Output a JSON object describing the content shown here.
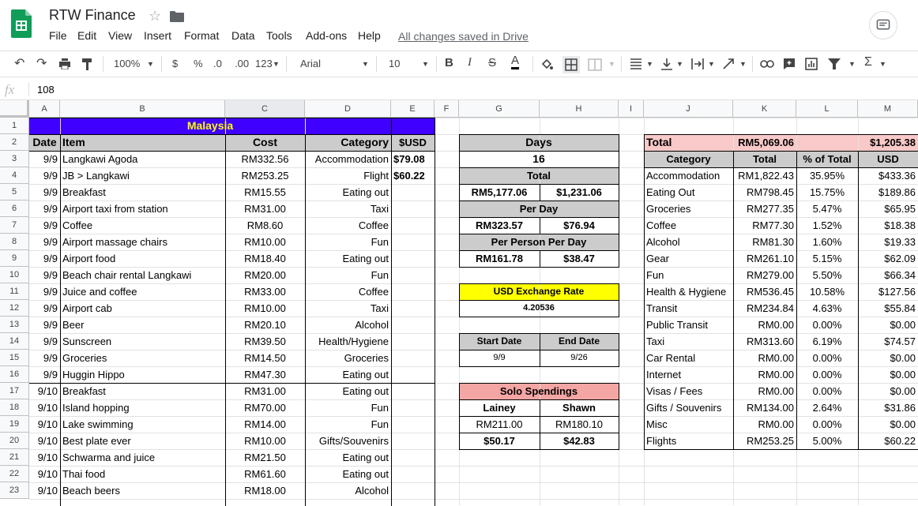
{
  "doc": {
    "title": "RTW Finance",
    "saved_status": "All changes saved in Drive",
    "menu": [
      "File",
      "Edit",
      "View",
      "Insert",
      "Format",
      "Data",
      "Tools",
      "Add-ons",
      "Help"
    ]
  },
  "toolbar": {
    "zoom": "100%",
    "currency": "$",
    "percent": "%",
    "dec_less": ".0",
    "dec_more": ".00",
    "format_more": "123",
    "font": "Arial",
    "font_size": "10"
  },
  "formula_bar": {
    "fx": "fx",
    "value": "108"
  },
  "columns": [
    "A",
    "B",
    "C",
    "D",
    "E",
    "F",
    "G",
    "H",
    "I",
    "J",
    "K",
    "L",
    "M"
  ],
  "rows": [
    "1",
    "2",
    "3",
    "4",
    "5",
    "6",
    "7",
    "8",
    "9",
    "10",
    "11",
    "12",
    "13",
    "14",
    "15",
    "16",
    "17",
    "18",
    "19",
    "20",
    "21",
    "22",
    "23"
  ],
  "left_table": {
    "banner": "Malaysia",
    "headers": {
      "date": "Date",
      "item": "Item",
      "cost": "Cost",
      "category": "Category",
      "usd": "$USD"
    },
    "rows": [
      {
        "date": "9/9",
        "item": "Langkawi Agoda",
        "cost": "RM332.56",
        "category": "Accommodation",
        "usd": "$79.08"
      },
      {
        "date": "9/9",
        "item": "JB > Langkawi",
        "cost": "RM253.25",
        "category": "Flight",
        "usd": "$60.22"
      },
      {
        "date": "9/9",
        "item": "Breakfast",
        "cost": "RM15.55",
        "category": "Eating out",
        "usd": ""
      },
      {
        "date": "9/9",
        "item": "Airport taxi from station",
        "cost": "RM31.00",
        "category": "Taxi",
        "usd": ""
      },
      {
        "date": "9/9",
        "item": "Coffee",
        "cost": "RM8.60",
        "category": "Coffee",
        "usd": ""
      },
      {
        "date": "9/9",
        "item": "Airport massage chairs",
        "cost": "RM10.00",
        "category": "Fun",
        "usd": ""
      },
      {
        "date": "9/9",
        "item": "Airport food",
        "cost": "RM18.40",
        "category": "Eating out",
        "usd": ""
      },
      {
        "date": "9/9",
        "item": "Beach chair rental Langkawi",
        "cost": "RM20.00",
        "category": "Fun",
        "usd": ""
      },
      {
        "date": "9/9",
        "item": "Juice and coffee",
        "cost": "RM33.00",
        "category": "Coffee",
        "usd": ""
      },
      {
        "date": "9/9",
        "item": "Airport cab",
        "cost": "RM10.00",
        "category": "Taxi",
        "usd": ""
      },
      {
        "date": "9/9",
        "item": "Beer",
        "cost": "RM20.10",
        "category": "Alcohol",
        "usd": ""
      },
      {
        "date": "9/9",
        "item": "Sunscreen",
        "cost": "RM39.50",
        "category": "Health/Hygiene",
        "usd": ""
      },
      {
        "date": "9/9",
        "item": "Groceries",
        "cost": "RM14.50",
        "category": "Groceries",
        "usd": ""
      },
      {
        "date": "9/9",
        "item": "Huggin Hippo",
        "cost": "RM47.30",
        "category": "Eating out",
        "usd": ""
      },
      {
        "date": "9/10",
        "item": "Breakfast",
        "cost": "RM31.00",
        "category": "Eating out",
        "usd": ""
      },
      {
        "date": "9/10",
        "item": "Island hopping",
        "cost": "RM70.00",
        "category": "Fun",
        "usd": ""
      },
      {
        "date": "9/10",
        "item": "Lake swimming",
        "cost": "RM14.00",
        "category": "Fun",
        "usd": ""
      },
      {
        "date": "9/10",
        "item": "Best plate ever",
        "cost": "RM10.00",
        "category": "Gifts/Souvenirs",
        "usd": ""
      },
      {
        "date": "9/10",
        "item": "Schwarma and juice",
        "cost": "RM21.50",
        "category": "Eating out",
        "usd": ""
      },
      {
        "date": "9/10",
        "item": "Thai food",
        "cost": "RM61.60",
        "category": "Eating out",
        "usd": ""
      },
      {
        "date": "9/10",
        "item": "Beach beers",
        "cost": "RM18.00",
        "category": "Alcohol",
        "usd": ""
      }
    ]
  },
  "mid": {
    "days_label": "Days",
    "days_value": "16",
    "total_label": "Total",
    "total_rm": "RM5,177.06",
    "total_usd": "$1,231.06",
    "per_day_label": "Per Day",
    "per_day_rm": "RM323.57",
    "per_day_usd": "$76.94",
    "pppd_label": "Per Person Per Day",
    "pppd_rm": "RM161.78",
    "pppd_usd": "$38.47",
    "rate_label": "USD Exchange Rate",
    "rate_value": "4.20536",
    "start_label": "Start Date",
    "end_label": "End Date",
    "start_value": "9/9",
    "end_value": "9/26",
    "solo_label": "Solo Spendings",
    "person1": "Lainey",
    "person2": "Shawn",
    "p1_rm": "RM211.00",
    "p2_rm": "RM180.10",
    "p1_usd": "$50.17",
    "p2_usd": "$42.83"
  },
  "summary": {
    "total_label": "Total",
    "total_rm": "RM5,069.06",
    "total_usd": "$1,205.38",
    "headers": {
      "category": "Category",
      "total": "Total",
      "pct": "% of Total",
      "usd": "USD"
    },
    "rows": [
      {
        "category": "Accommodation",
        "total": "RM1,822.43",
        "pct": "35.95%",
        "usd": "$433.36"
      },
      {
        "category": "Eating Out",
        "total": "RM798.45",
        "pct": "15.75%",
        "usd": "$189.86"
      },
      {
        "category": "Groceries",
        "total": "RM277.35",
        "pct": "5.47%",
        "usd": "$65.95"
      },
      {
        "category": "Coffee",
        "total": "RM77.30",
        "pct": "1.52%",
        "usd": "$18.38"
      },
      {
        "category": "Alcohol",
        "total": "RM81.30",
        "pct": "1.60%",
        "usd": "$19.33"
      },
      {
        "category": "Gear",
        "total": "RM261.10",
        "pct": "5.15%",
        "usd": "$62.09"
      },
      {
        "category": "Fun",
        "total": "RM279.00",
        "pct": "5.50%",
        "usd": "$66.34"
      },
      {
        "category": "Health & Hygiene",
        "total": "RM536.45",
        "pct": "10.58%",
        "usd": "$127.56"
      },
      {
        "category": "Transit",
        "total": "RM234.84",
        "pct": "4.63%",
        "usd": "$55.84"
      },
      {
        "category": "Public Transit",
        "total": "RM0.00",
        "pct": "0.00%",
        "usd": "$0.00"
      },
      {
        "category": "Taxi",
        "total": "RM313.60",
        "pct": "6.19%",
        "usd": "$74.57"
      },
      {
        "category": "Car Rental",
        "total": "RM0.00",
        "pct": "0.00%",
        "usd": "$0.00"
      },
      {
        "category": "Internet",
        "total": "RM0.00",
        "pct": "0.00%",
        "usd": "$0.00"
      },
      {
        "category": "Visas / Fees",
        "total": "RM0.00",
        "pct": "0.00%",
        "usd": "$0.00"
      },
      {
        "category": "Gifts / Souvenirs",
        "total": "RM134.00",
        "pct": "2.64%",
        "usd": "$31.86"
      },
      {
        "category": "Misc",
        "total": "RM0.00",
        "pct": "0.00%",
        "usd": "$0.00"
      },
      {
        "category": "Flights",
        "total": "RM253.25",
        "pct": "5.00%",
        "usd": "$60.22"
      }
    ]
  },
  "colors": {
    "banner_bg": "#3f00ff",
    "banner_text": "#ffff00",
    "header_gray": "#cccccc",
    "yellow": "#ffff00",
    "salmon": "#f4a6a4",
    "pink": "#f8c9c8"
  }
}
